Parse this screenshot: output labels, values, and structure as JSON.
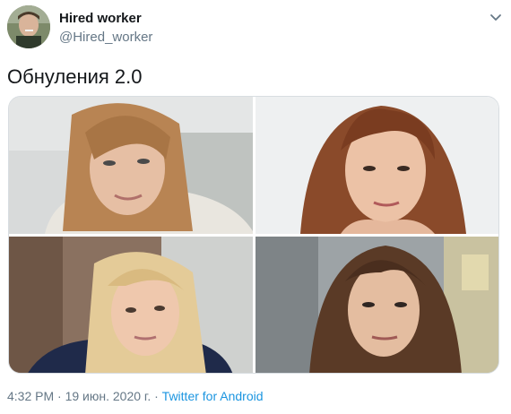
{
  "tweet": {
    "author": {
      "display_name": "Hired worker",
      "handle": "@Hired_worker",
      "avatar_icon": "profile-avatar"
    },
    "text": "Обнуления 2.0",
    "media": {
      "count": 4,
      "photos": [
        {
          "description_icon": "photo-woman-light-brown-hair"
        },
        {
          "description_icon": "photo-woman-auburn-hair"
        },
        {
          "description_icon": "photo-woman-blonde-hair"
        },
        {
          "description_icon": "photo-woman-dark-brown-hair"
        }
      ]
    },
    "footer": {
      "time": "4:32 PM",
      "separator1": " · ",
      "date": "19 июн. 2020 г.",
      "separator2": " · ",
      "source": "Twitter for Android"
    },
    "menu_icon": "chevron-down-icon"
  },
  "colors": {
    "text": "#14171a",
    "secondary": "#657786",
    "link": "#1b95e0",
    "border": "#d8dde1"
  }
}
